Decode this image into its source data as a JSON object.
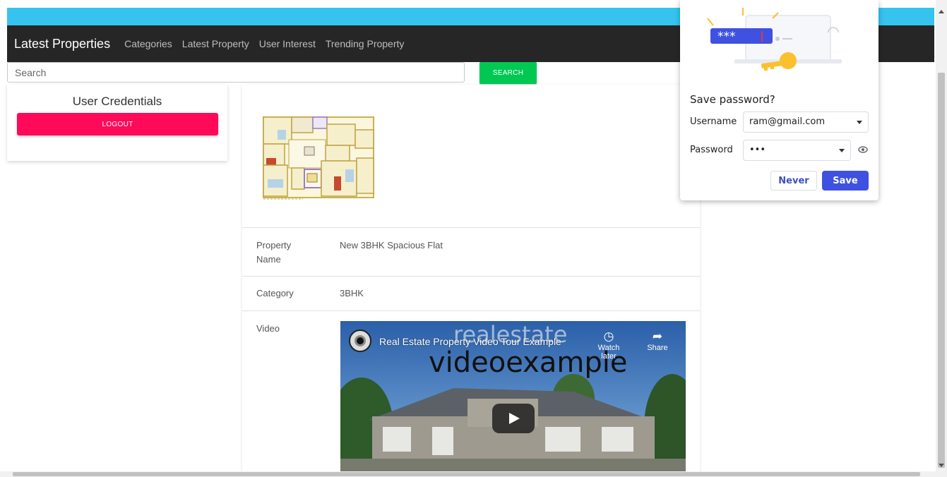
{
  "navbar": {
    "brand": "Latest Properties",
    "links": [
      "Categories",
      "Latest Property",
      "User Interest",
      "Trending Property"
    ]
  },
  "search": {
    "placeholder": "Search",
    "button_label": "SEARCH"
  },
  "credentials": {
    "title": "User Credentials",
    "logout_label": "LOGOUT"
  },
  "property": {
    "fields": [
      {
        "label": "Property Name",
        "value": "New 3BHK Spacious Flat"
      },
      {
        "label": "Category",
        "value": "3BHK"
      },
      {
        "label": "Video",
        "value": ""
      }
    ],
    "video": {
      "title": "Real Estate Property Video Tour Example",
      "overlay_line1": "realestate",
      "overlay_line2": "videoexample",
      "watch_later_label": "Watch later",
      "share_label": "Share"
    }
  },
  "password_popup": {
    "title": "Save password?",
    "username_label": "Username",
    "username_value": "ram@gmail.com",
    "password_label": "Password",
    "password_value": "•••",
    "never_label": "Never",
    "save_label": "Save",
    "illustration_text": "***"
  },
  "colors": {
    "top_strip": "#36c3ef",
    "navbar": "#262626",
    "search_button": "#00c853",
    "logout_button": "#ff0a58",
    "save_button": "#3f51e0"
  }
}
